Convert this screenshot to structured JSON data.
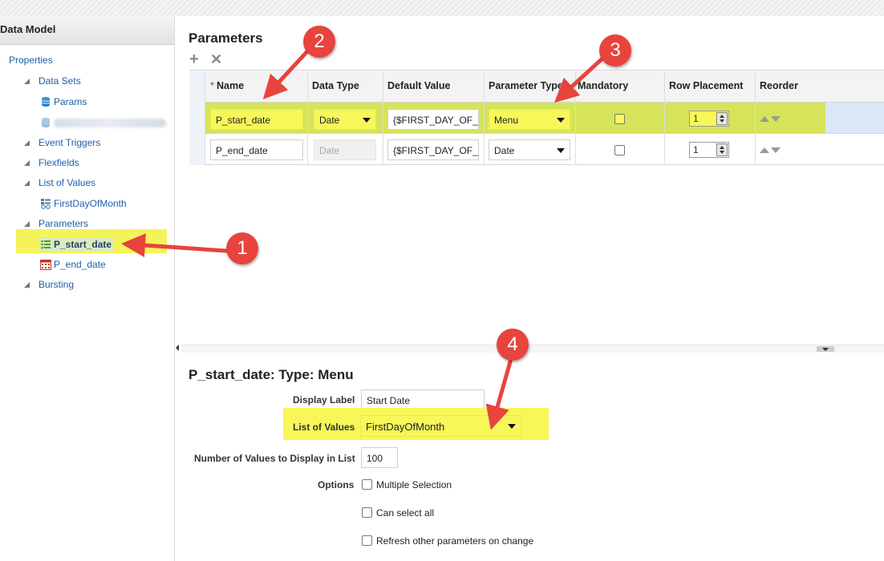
{
  "left_panel": {
    "title": "Data Model",
    "tree": {
      "properties": "Properties",
      "data_sets": "Data Sets",
      "params_ds": "Params",
      "event_triggers": "Event Triggers",
      "flexfields": "Flexfields",
      "list_of_values": "List of Values",
      "lov_first_day": "FirstDayOfMonth",
      "parameters": "Parameters",
      "p_start_date": "P_start_date",
      "p_end_date": "P_end_date",
      "bursting": "Bursting"
    }
  },
  "parameters_panel": {
    "title": "Parameters",
    "toolbar": {
      "add_icon": "+",
      "delete_icon": "✕"
    },
    "columns": {
      "required_mark": "*",
      "name": "Name",
      "data_type": "Data Type",
      "default_value": "Default Value",
      "parameter_type": "Parameter Type",
      "mandatory": "Mandatory",
      "row_placement": "Row Placement",
      "reorder": "Reorder"
    },
    "rows": [
      {
        "name": "P_start_date",
        "data_type": "Date",
        "default_value": "{$FIRST_DAY_OF_",
        "parameter_type": "Menu",
        "mandatory": false,
        "row_placement": "1",
        "selected": true
      },
      {
        "name": "P_end_date",
        "data_type": "Date",
        "default_value": "{$FIRST_DAY_OF_",
        "parameter_type": "Date",
        "mandatory": false,
        "row_placement": "1",
        "selected": false
      }
    ]
  },
  "detail_panel": {
    "title": "P_start_date: Type: Menu",
    "display_label": {
      "label": "Display Label",
      "value": "Start Date"
    },
    "list_of_values": {
      "label": "List of Values",
      "value": "FirstDayOfMonth"
    },
    "num_values": {
      "label": "Number of Values to Display in List",
      "value": "100"
    },
    "options": {
      "label": "Options",
      "items": [
        "Multiple Selection",
        "Can select all",
        "Refresh other parameters on change"
      ]
    }
  },
  "annotations": [
    "1",
    "2",
    "3",
    "4"
  ],
  "colors": {
    "highlight": "#f7f75a",
    "badge": "#e8433d",
    "link": "#1f5fa8",
    "selected_row": "#dbe8f7"
  }
}
